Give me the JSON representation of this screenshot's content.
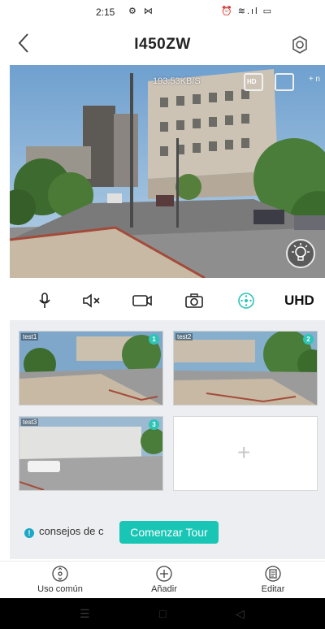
{
  "status_bar": {
    "time": "2:15",
    "left_icons": "⚙ ⋈",
    "right_icons": "⏰ ≋.ıl ▭"
  },
  "header": {
    "title": "I450ZW",
    "back_icon": "chevron-left-icon",
    "settings_icon": "gear-icon"
  },
  "live_view": {
    "bitrate": "193.53KB/S",
    "hd_badge": "HD",
    "fn_text": "+ n"
  },
  "toolbar": {
    "items": [
      "microphone-icon",
      "speaker-mute-icon",
      "record-icon",
      "camera-icon",
      "ptz-icon"
    ],
    "quality": "UHD",
    "accent_color": "#2ec4b6"
  },
  "presets": [
    {
      "label": "test1",
      "number": "1"
    },
    {
      "label": "test2",
      "number": "2"
    },
    {
      "label": "test3",
      "number": "3"
    }
  ],
  "add_preset": {
    "symbol": "+"
  },
  "tip": {
    "icon": "!",
    "text": "consejos de c",
    "button": "Comenzar Tour"
  },
  "bottom_nav": [
    {
      "label": "Uso común",
      "icon": "joystick-icon"
    },
    {
      "label": "Añadir",
      "icon": "plus-circle-icon"
    },
    {
      "label": "Editar",
      "icon": "edit-icon"
    }
  ],
  "system_nav": {
    "menu": "☰",
    "home": "□",
    "back": "◁"
  }
}
